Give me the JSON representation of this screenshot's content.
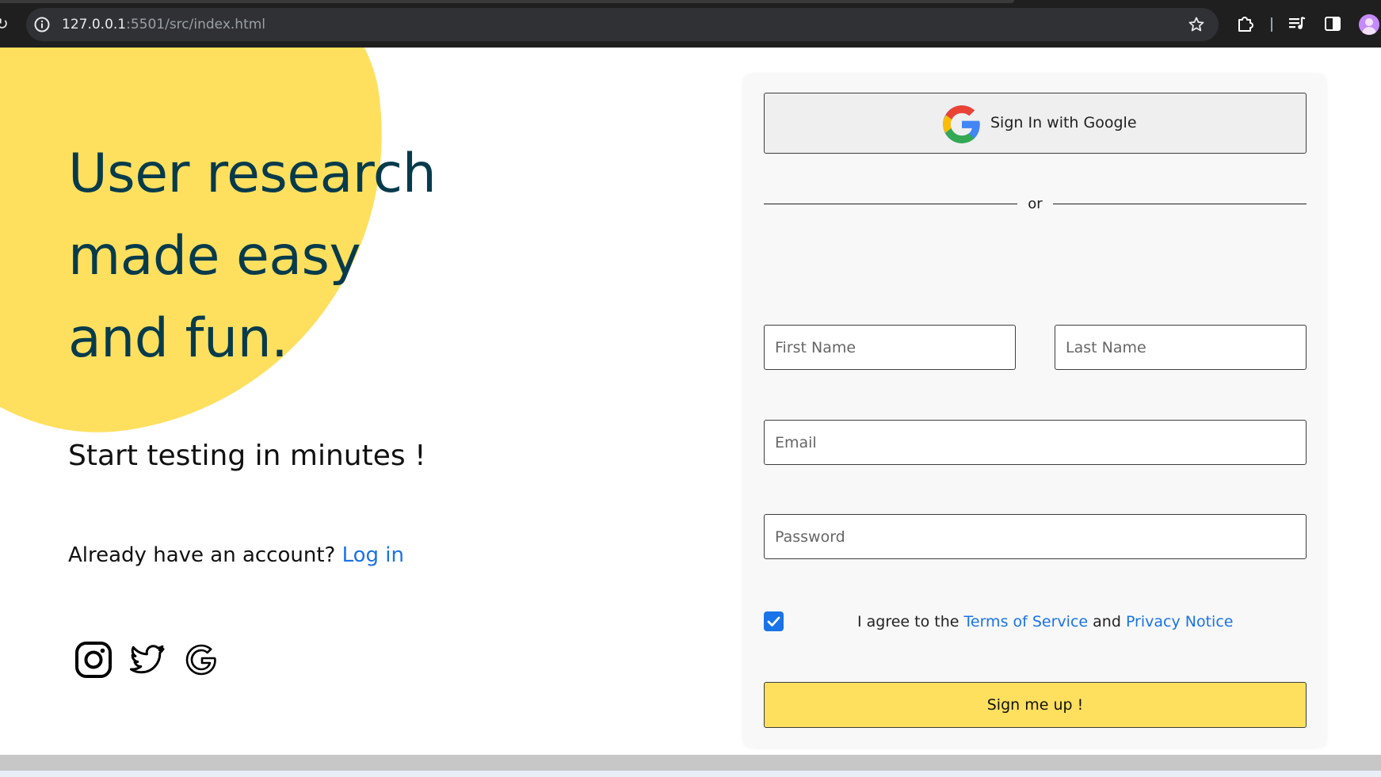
{
  "browser": {
    "url_host": "127.0.0.1",
    "url_path": ":5501/src/index.html"
  },
  "hero": {
    "title_line1": "User research",
    "title_line2": "made easy",
    "title_line3": "and fun.",
    "tagline": "Start testing in minutes !",
    "account_prompt": "Already have an account?",
    "login_link": "Log in",
    "socials": [
      "instagram-icon",
      "twitter-icon",
      "google-icon"
    ]
  },
  "form": {
    "google_button_label": "Sign In with Google",
    "divider_text": "or",
    "first_name_placeholder": "First Name",
    "last_name_placeholder": "Last Name",
    "email_placeholder": "Email",
    "password_placeholder": "Password",
    "agree_checked": true,
    "agree_prefix": "I agree to the",
    "terms_link": "Terms of Service",
    "agree_and": "and",
    "privacy_link": "Privacy Notice",
    "submit_label": "Sign me up !"
  },
  "colors": {
    "accent_yellow": "#ffe05e",
    "title_navy": "#073b4c",
    "link_blue": "#1a73e8"
  }
}
